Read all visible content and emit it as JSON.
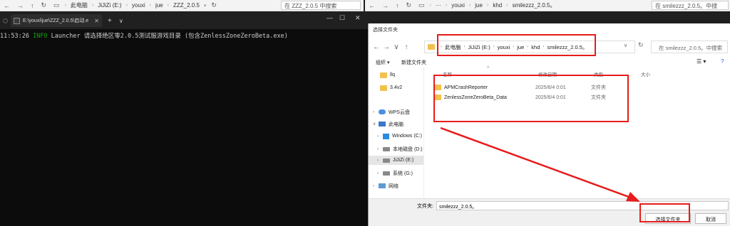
{
  "explorer_left": {
    "crumbs": [
      "此电脑",
      "JiJiZi (E:)",
      "youxi",
      "jue",
      "ZZZ_2.0.5"
    ],
    "search_placeholder": "在 ZZZ_2.0.5 中搜索"
  },
  "explorer_right": {
    "crumbs": [
      "···",
      "youxi",
      "jue",
      "khd",
      "smilezzz_2.0.5。"
    ],
    "search_placeholder": "在 smilezzz_2.0.5。中搜"
  },
  "terminal": {
    "tab_title": "E:\\youxi\\jue\\ZZZ_2.0.5\\启动.e",
    "line": {
      "time": "11:53:26",
      "level": "INFO",
      "message": " Launcher 请选择绝区零2.0.5测试服游戏目录 (包含ZenlessZoneZeroBeta.exe)"
    }
  },
  "dialog": {
    "title": "选择文件夹",
    "address": [
      "此电脑",
      "JiJiZi (E:)",
      "youxi",
      "jue",
      "khd",
      "smilezzz_2.0.5。"
    ],
    "search_placeholder": "在 smilezzz_2.0.5。中搜索",
    "toolbar": {
      "organize": "组织 ▾",
      "new_folder": "新建文件夹"
    },
    "columns": {
      "name": "名称",
      "date": "修改日期",
      "type": "类型",
      "size": "大小"
    },
    "sidebar": [
      {
        "label": "llq",
        "icon": "folder-icon"
      },
      {
        "label": "3.4v2",
        "icon": "folder-icon"
      },
      {
        "label": "WPS云盘",
        "icon": "cloud-icon"
      },
      {
        "label": "此电脑",
        "icon": "pc-icon"
      },
      {
        "label": "Windows (C:)",
        "icon": "windows-drive-icon"
      },
      {
        "label": "本地磁盘 (D:)",
        "icon": "drive-icon"
      },
      {
        "label": "JiJiZi (E:)",
        "icon": "drive-icon"
      },
      {
        "label": "系统 (G:)",
        "icon": "drive-icon"
      },
      {
        "label": "网络",
        "icon": "network-icon"
      }
    ],
    "files": [
      {
        "name": "APMCrashReporter",
        "date": "2025/6/4 0:01",
        "type": "文件夹"
      },
      {
        "name": "ZenlessZoneZeroBeta_Data",
        "date": "2025/6/4 0:01",
        "type": "文件夹"
      }
    ],
    "folder_label": "文件夹:",
    "folder_value": "smilezzz_2.0.5。",
    "select_button": "选择文件夹",
    "cancel_button": "取消"
  },
  "colors": {
    "annotation": "#e81c1c",
    "terminal_info": "#13a10e",
    "folder": "#f2c14e"
  }
}
